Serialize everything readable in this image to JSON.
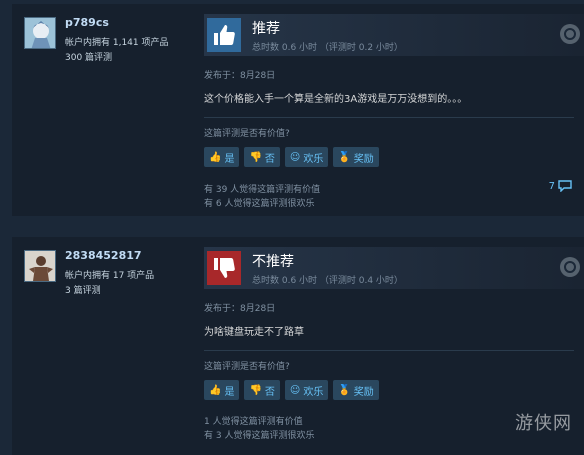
{
  "reviews": [
    {
      "author": "p789cs",
      "products": "帐户内拥有 1,141 项产品",
      "review_count": "300 篇评测",
      "verdict": "推荐",
      "hours": "总时数 0.6 小时 （评测时 0.2 小时）",
      "posted": "发布于：8月28日",
      "text": "这个价格能入手一个算是全新的3A游戏是万万没想到的。。。",
      "helpful_question": "这篇评测是否有价值?",
      "buttons": {
        "yes": "是",
        "no": "否",
        "funny": "欢乐",
        "award": "奖励"
      },
      "helpful_count": "有 39 人觉得这篇评测有价值",
      "funny_count": "有 6 人觉得这篇评测很欢乐",
      "comments": "7"
    },
    {
      "author": "2838452817",
      "products": "帐户内拥有 17 项产品",
      "review_count": "3 篇评测",
      "verdict": "不推荐",
      "hours": "总时数 0.6 小时 （评测时 0.4 小时）",
      "posted": "发布于：8月28日",
      "text": "为啥键盘玩走不了路草",
      "helpful_question": "这篇评测是否有价值?",
      "buttons": {
        "yes": "是",
        "no": "否",
        "funny": "欢乐",
        "award": "奖励"
      },
      "helpful_count": "1 人觉得这篇评测有价值",
      "funny_count": "有 3 人觉得这篇评测很欢乐"
    }
  ],
  "watermark": "游侠网"
}
